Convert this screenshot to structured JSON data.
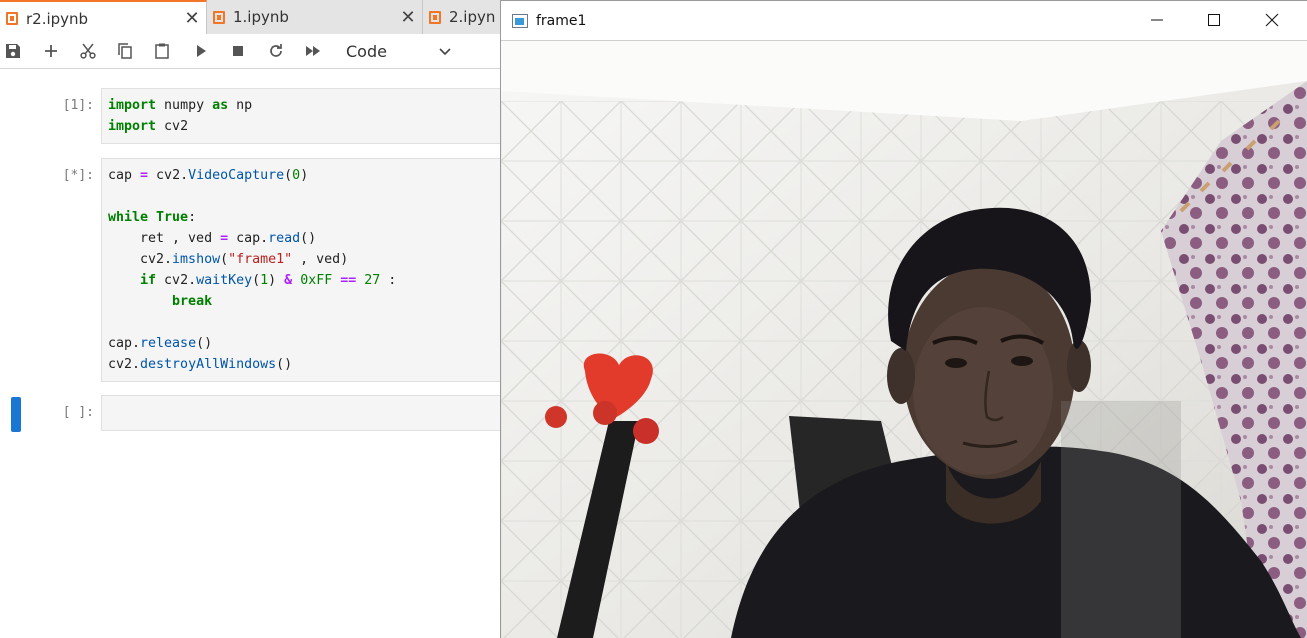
{
  "tabs": [
    {
      "label": "r2.ipynb",
      "active": true
    },
    {
      "label": "1.ipynb",
      "active": false
    },
    {
      "label": "2.ipyn",
      "active": false
    }
  ],
  "toolbar": {
    "buttons": [
      "save-icon",
      "add-icon",
      "cut-icon",
      "copy-icon",
      "paste-icon",
      "run-icon",
      "stop-icon",
      "restart-icon",
      "fast-forward-icon"
    ],
    "cell_type": "Code"
  },
  "cells": [
    {
      "prompt": "[1]:"
    },
    {
      "prompt": "[*]:"
    },
    {
      "prompt": "[ ]:"
    }
  ],
  "code": {
    "c1_import": "import",
    "c1_numpy": " numpy ",
    "c1_as": "as",
    "c1_np": " np",
    "c1_import2": "import",
    "c1_cv2": " cv2",
    "c2_l1a": "cap ",
    "c2_l1eq": "=",
    "c2_l1b": " cv2.",
    "c2_l1fn": "VideoCapture",
    "c2_l1c": "(",
    "c2_l1num": "0",
    "c2_l1d": ")",
    "c2_while": "while",
    "c2_true": " True",
    "c2_colon": ":",
    "c2_l3a": "    ret , ved ",
    "c2_l3eq": "=",
    "c2_l3b": " cap.",
    "c2_l3fn": "read",
    "c2_l3c": "()",
    "c2_l4a": "    cv2.",
    "c2_l4fn": "imshow",
    "c2_l4b": "(",
    "c2_l4str": "\"frame1\"",
    "c2_l4c": " , ved)",
    "c2_l5indent": "    ",
    "c2_if": "if",
    "c2_l5a": " cv2.",
    "c2_l5fn": "waitKey",
    "c2_l5b": "(",
    "c2_l5n1": "1",
    "c2_l5c": ") ",
    "c2_amp": "&",
    "c2_l5d": " ",
    "c2_hex": "0xFF",
    "c2_l5e": " ",
    "c2_eqeq": "==",
    "c2_l5f": " ",
    "c2_27": "27",
    "c2_l5g": " :",
    "c2_l6indent": "        ",
    "c2_break": "break",
    "c2_l8a": "cap.",
    "c2_l8fn": "release",
    "c2_l8b": "()",
    "c2_l9a": "cv2.",
    "c2_l9fn": "destroyAllWindows",
    "c2_l9b": "()"
  },
  "window": {
    "title": "frame1",
    "controls": [
      "minimize-icon",
      "maximize-icon",
      "close-icon"
    ]
  },
  "colors": {
    "jupyter_orange": "#f37626",
    "active_cell_marker": "#1976d2",
    "keyword_green": "#008000",
    "operator_purple": "#aa22ff",
    "string_red": "#ba2121"
  }
}
